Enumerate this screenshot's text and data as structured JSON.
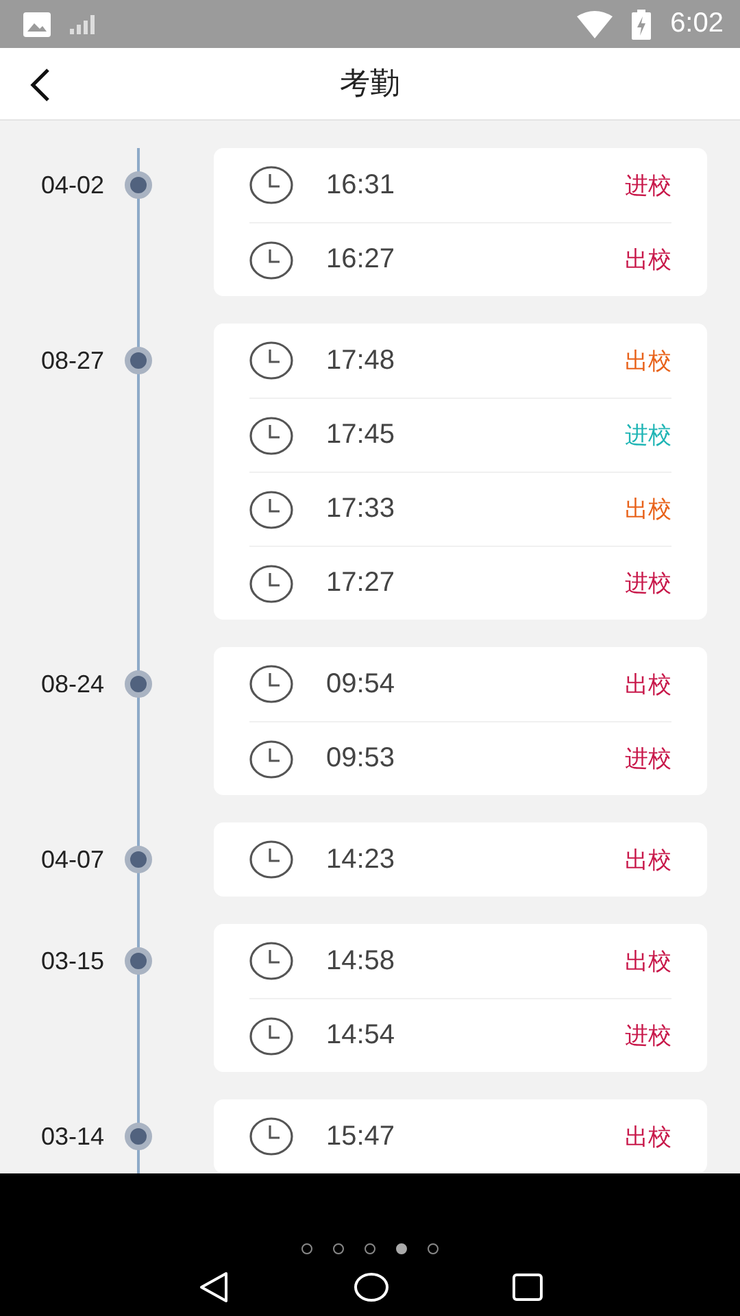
{
  "status_bar": {
    "time": "6:02"
  },
  "header": {
    "title": "考勤"
  },
  "days": [
    {
      "date": "04-02",
      "records": [
        {
          "time": "16:31",
          "label": "进校",
          "color": "#c8184a"
        },
        {
          "time": "16:27",
          "label": "出校",
          "color": "#c8184a"
        }
      ]
    },
    {
      "date": "08-27",
      "records": [
        {
          "time": "17:48",
          "label": "出校",
          "color": "#e8621a"
        },
        {
          "time": "17:45",
          "label": "进校",
          "color": "#1fb5b5"
        },
        {
          "time": "17:33",
          "label": "出校",
          "color": "#e8621a"
        },
        {
          "time": "17:27",
          "label": "进校",
          "color": "#c8184a"
        }
      ]
    },
    {
      "date": "08-24",
      "records": [
        {
          "time": "09:54",
          "label": "出校",
          "color": "#c8184a"
        },
        {
          "time": "09:53",
          "label": "进校",
          "color": "#c8184a"
        }
      ]
    },
    {
      "date": "04-07",
      "records": [
        {
          "time": "14:23",
          "label": "出校",
          "color": "#c8184a"
        }
      ]
    },
    {
      "date": "03-15",
      "records": [
        {
          "time": "14:58",
          "label": "出校",
          "color": "#c8184a"
        },
        {
          "time": "14:54",
          "label": "进校",
          "color": "#c8184a"
        }
      ]
    },
    {
      "date": "03-14",
      "records": [
        {
          "time": "15:47",
          "label": "出校",
          "color": "#c8184a"
        }
      ]
    }
  ],
  "pager": [
    {
      "selected": false
    },
    {
      "selected": false
    },
    {
      "selected": false
    },
    {
      "selected": true
    },
    {
      "selected": false
    }
  ]
}
